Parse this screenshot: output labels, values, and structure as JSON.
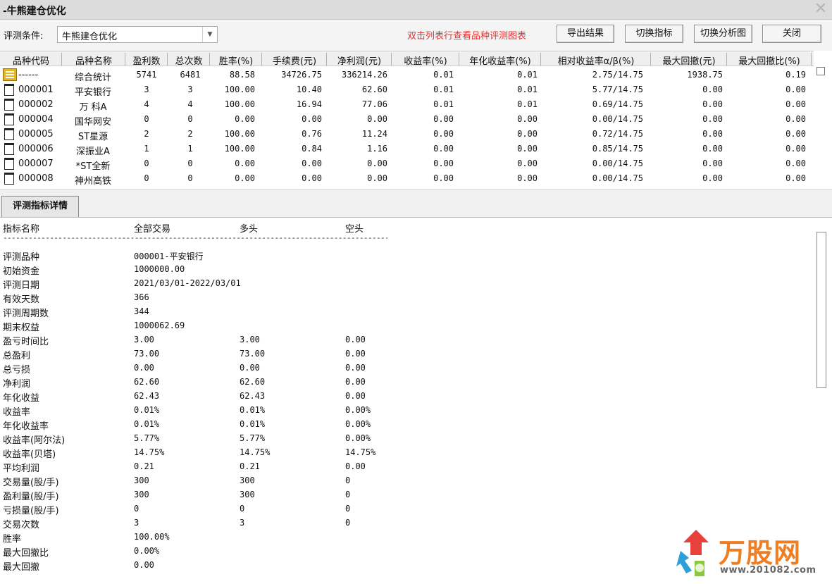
{
  "window": {
    "title": "-牛熊建仓优化"
  },
  "toolbar": {
    "condition_label": "评测条件:",
    "condition_value": "牛熊建仓优化",
    "hint": "双击列表行查看品种评测图表",
    "hint_color": "#e23232",
    "buttons": {
      "export": "导出结果",
      "switch_indicator": "切换指标",
      "switch_chart": "切换分析图",
      "close": "关闭"
    }
  },
  "grid": {
    "headers": [
      "品种代码",
      "品种名称",
      "盈利数",
      "总次数",
      "胜率(%)",
      "手续费(元)",
      "净利润(元)",
      "收益率(%)",
      "年化收益率(%)",
      "相对收益率α/β(%)",
      "最大回撤(元)",
      "最大回撤比(%)"
    ],
    "rows": [
      {
        "code": "------",
        "name": "综合统计",
        "win": "5741",
        "total": "6481",
        "rate": "88.58",
        "fee": "34726.75",
        "profit": "336214.26",
        "ret": "0.01",
        "annual": "0.01",
        "alpha": "2.75/14.75",
        "dd": "1938.75",
        "ddr": "0.19"
      },
      {
        "code": "000001",
        "name": "平安银行",
        "win": "3",
        "total": "3",
        "rate": "100.00",
        "fee": "10.40",
        "profit": "62.60",
        "ret": "0.01",
        "annual": "0.01",
        "alpha": "5.77/14.75",
        "dd": "0.00",
        "ddr": "0.00"
      },
      {
        "code": "000002",
        "name": "万 科A",
        "win": "4",
        "total": "4",
        "rate": "100.00",
        "fee": "16.94",
        "profit": "77.06",
        "ret": "0.01",
        "annual": "0.01",
        "alpha": "0.69/14.75",
        "dd": "0.00",
        "ddr": "0.00"
      },
      {
        "code": "000004",
        "name": "国华网安",
        "win": "0",
        "total": "0",
        "rate": "0.00",
        "fee": "0.00",
        "profit": "0.00",
        "ret": "0.00",
        "annual": "0.00",
        "alpha": "0.00/14.75",
        "dd": "0.00",
        "ddr": "0.00"
      },
      {
        "code": "000005",
        "name": "ST星源",
        "win": "2",
        "total": "2",
        "rate": "100.00",
        "fee": "0.76",
        "profit": "11.24",
        "ret": "0.00",
        "annual": "0.00",
        "alpha": "0.72/14.75",
        "dd": "0.00",
        "ddr": "0.00"
      },
      {
        "code": "000006",
        "name": "深振业A",
        "win": "1",
        "total": "1",
        "rate": "100.00",
        "fee": "0.84",
        "profit": "1.16",
        "ret": "0.00",
        "annual": "0.00",
        "alpha": "0.85/14.75",
        "dd": "0.00",
        "ddr": "0.00"
      },
      {
        "code": "000007",
        "name": "*ST全新",
        "win": "0",
        "total": "0",
        "rate": "0.00",
        "fee": "0.00",
        "profit": "0.00",
        "ret": "0.00",
        "annual": "0.00",
        "alpha": "0.00/14.75",
        "dd": "0.00",
        "ddr": "0.00"
      },
      {
        "code": "000008",
        "name": "神州高铁",
        "win": "0",
        "total": "0",
        "rate": "0.00",
        "fee": "0.00",
        "profit": "0.00",
        "ret": "0.00",
        "annual": "0.00",
        "alpha": "0.00/14.75",
        "dd": "0.00",
        "ddr": "0.00"
      }
    ]
  },
  "detail": {
    "tab_label": "评测指标详情",
    "headers": {
      "name": "指标名称",
      "all": "全部交易",
      "long": "多头",
      "short": "空头"
    },
    "separator": "--------------------------------------------------------------------------------------------",
    "rows": [
      {
        "name": "评测品种",
        "all": "000001-平安银行",
        "long": "",
        "short": ""
      },
      {
        "name": "初始资金",
        "all": "1000000.00",
        "long": "",
        "short": ""
      },
      {
        "name": "评测日期",
        "all": "2021/03/01-2022/03/01",
        "long": "",
        "short": ""
      },
      {
        "name": "有效天数",
        "all": "366",
        "long": "",
        "short": ""
      },
      {
        "name": "评测周期数",
        "all": "344",
        "long": "",
        "short": ""
      },
      {
        "name": "期末权益",
        "all": "1000062.69",
        "long": "",
        "short": ""
      },
      {
        "name": "盈亏时间比",
        "all": "3.00",
        "long": "3.00",
        "short": "0.00"
      },
      {
        "name": "总盈利",
        "all": "73.00",
        "long": "73.00",
        "short": "0.00"
      },
      {
        "name": "总亏损",
        "all": "0.00",
        "long": "0.00",
        "short": "0.00"
      },
      {
        "name": "净利润",
        "all": "62.60",
        "long": "62.60",
        "short": "0.00"
      },
      {
        "name": "年化收益",
        "all": "62.43",
        "long": "62.43",
        "short": "0.00"
      },
      {
        "name": "收益率",
        "all": "0.01%",
        "long": "0.01%",
        "short": "0.00%"
      },
      {
        "name": "年化收益率",
        "all": "0.01%",
        "long": "0.01%",
        "short": "0.00%"
      },
      {
        "name": "收益率(阿尔法)",
        "all": "5.77%",
        "long": "5.77%",
        "short": "0.00%"
      },
      {
        "name": "收益率(贝塔)",
        "all": "14.75%",
        "long": "14.75%",
        "short": "14.75%"
      },
      {
        "name": "平均利润",
        "all": "0.21",
        "long": "0.21",
        "short": "0.00"
      },
      {
        "name": "交易量(股/手)",
        "all": "300",
        "long": "300",
        "short": "0"
      },
      {
        "name": "盈利量(股/手)",
        "all": "300",
        "long": "300",
        "short": "0"
      },
      {
        "name": "亏损量(股/手)",
        "all": "0",
        "long": "0",
        "short": "0"
      },
      {
        "name": "交易次数",
        "all": "3",
        "long": "3",
        "short": "0"
      },
      {
        "name": "胜率",
        "all": "100.00%",
        "long": "",
        "short": ""
      },
      {
        "name": "最大回撤比",
        "all": "0.00%",
        "long": "",
        "short": ""
      },
      {
        "name": "最大回撤",
        "all": "0.00",
        "long": "",
        "short": ""
      }
    ]
  },
  "watermark": {
    "logo_text": "万股网",
    "url": "www.201082.com"
  }
}
